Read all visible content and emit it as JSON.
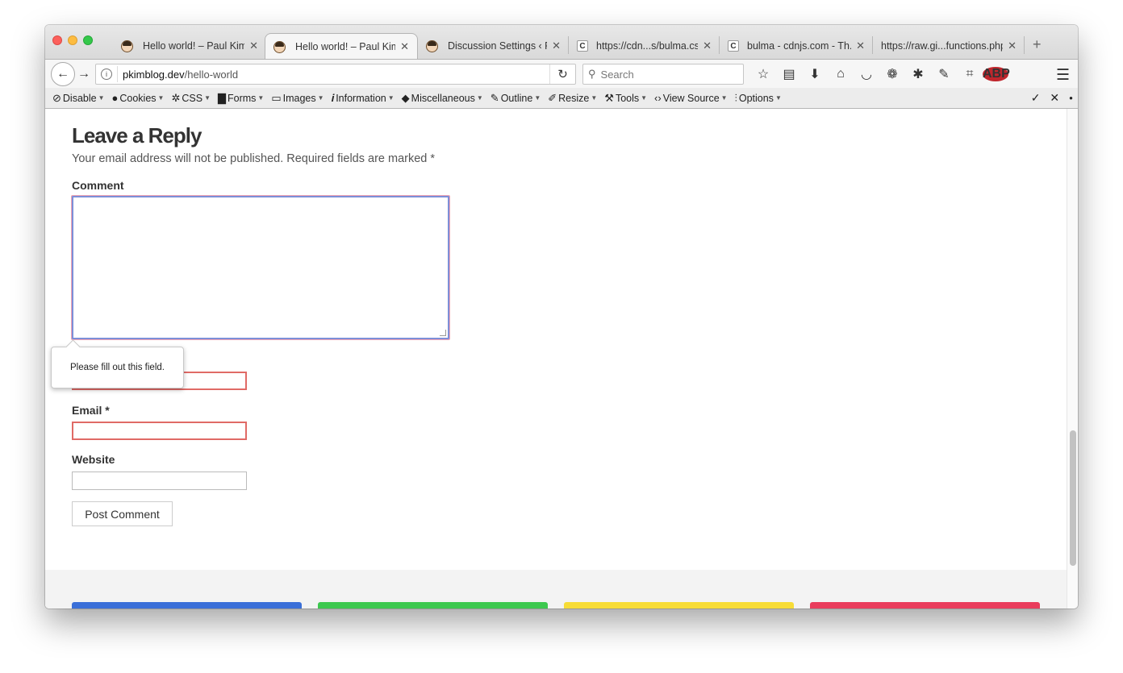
{
  "browser": {
    "tabs": [
      {
        "title": "Hello world! – Paul Kim",
        "favicon": "face-avatar",
        "active": false
      },
      {
        "title": "Hello world! – Paul Kim",
        "favicon": "face-avatar",
        "active": true
      },
      {
        "title": "Discussion Settings ‹ P...",
        "favicon": "face-avatar",
        "active": false
      },
      {
        "title": "https://cdn...s/bulma.css",
        "favicon": "c-letter",
        "active": false
      },
      {
        "title": "bulma - cdnjs.com - Th...",
        "favicon": "c-letter",
        "active": false
      },
      {
        "title": "https://raw.gi...functions.php",
        "favicon": "none",
        "active": false
      }
    ],
    "url_host": "pkimblog.dev",
    "url_path": "/hello-world",
    "search_placeholder": "Search",
    "abp_label": "ABP"
  },
  "webdev_toolbar": {
    "items": [
      "Disable",
      "Cookies",
      "CSS",
      "Forms",
      "Images",
      "Information",
      "Miscellaneous",
      "Outline",
      "Resize",
      "Tools",
      "View Source",
      "Options"
    ]
  },
  "page": {
    "reply_title": "Leave a Reply",
    "reply_note": "Your email address will not be published. Required fields are marked *",
    "comment_label": "Comment",
    "email_label": "Email *",
    "website_label": "Website",
    "post_button": "Post Comment",
    "validation_tooltip": "Please fill out this field."
  },
  "colors": {
    "footer_bars": [
      "#3a6fd8",
      "#3dc84f",
      "#f7dc36",
      "#e93c5c"
    ],
    "invalid_border": "#e06a66",
    "focus_border": "#7d8fd8"
  }
}
